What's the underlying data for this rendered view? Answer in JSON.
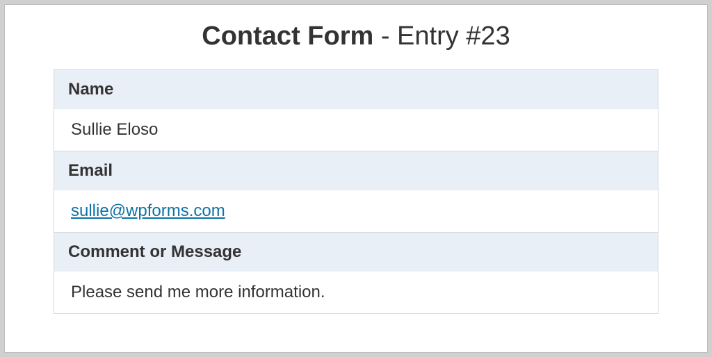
{
  "header": {
    "form_name": "Contact Form",
    "entry_suffix": " - Entry #23"
  },
  "fields": [
    {
      "label": "Name",
      "value": "Sullie Eloso",
      "is_link": false
    },
    {
      "label": "Email",
      "value": "sullie@wpforms.com",
      "is_link": true
    },
    {
      "label": "Comment or Message",
      "value": "Please send me more information.",
      "is_link": false
    }
  ]
}
